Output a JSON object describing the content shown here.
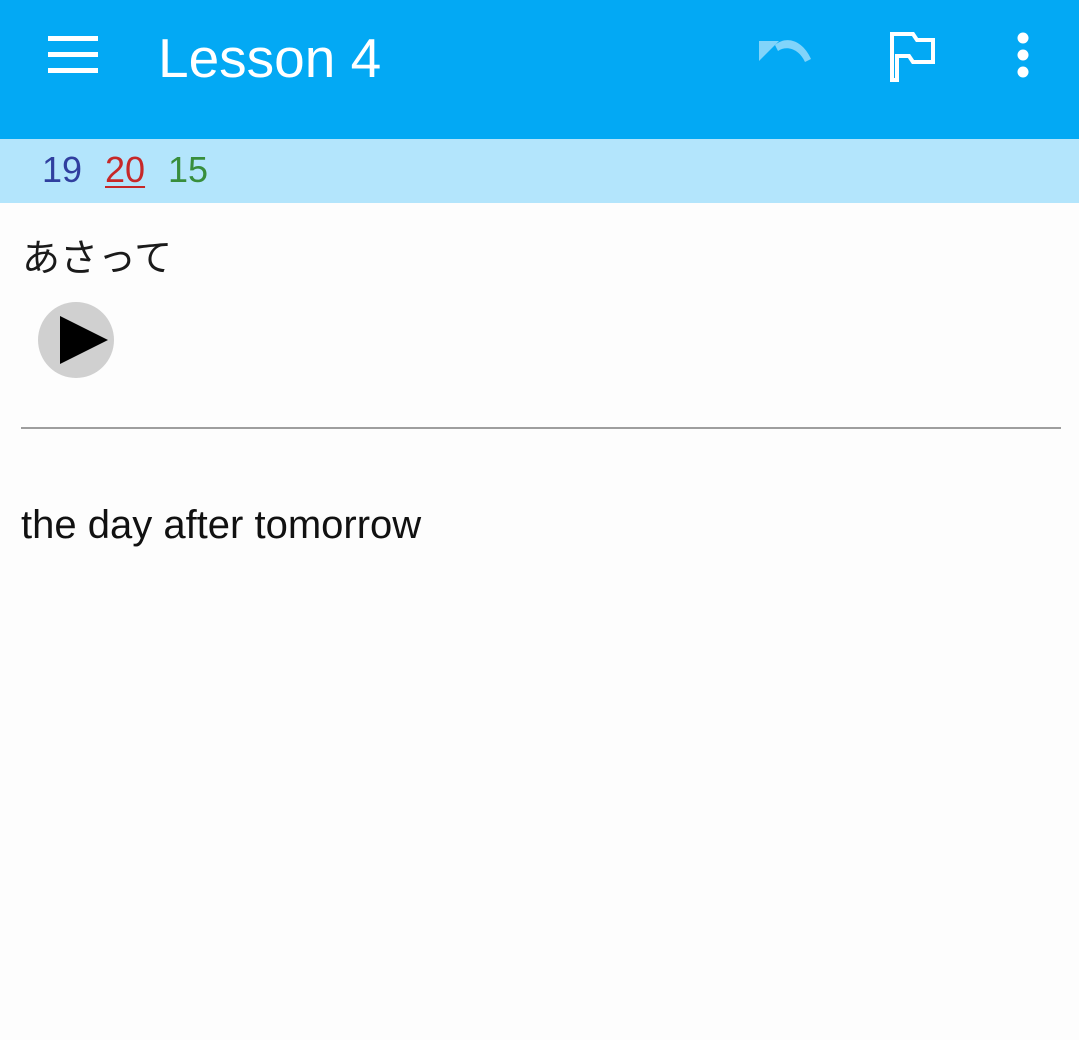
{
  "toolbar": {
    "title": "Lesson 4",
    "icons": {
      "menu": "menu-icon",
      "undo": "undo-icon",
      "flag": "flag-icon",
      "more": "more-vert-icon"
    },
    "background_color": "#03a9f4",
    "undo_enabled": false
  },
  "counts": {
    "new": "19",
    "learning": "20",
    "review": "15",
    "new_color": "#303f9f",
    "learning_color": "#c62828",
    "review_color": "#388e3c",
    "bar_color": "#b3e5fc"
  },
  "card": {
    "question": "あさって",
    "answer": "the day after tomorrow",
    "audio_icon": "play-icon"
  }
}
